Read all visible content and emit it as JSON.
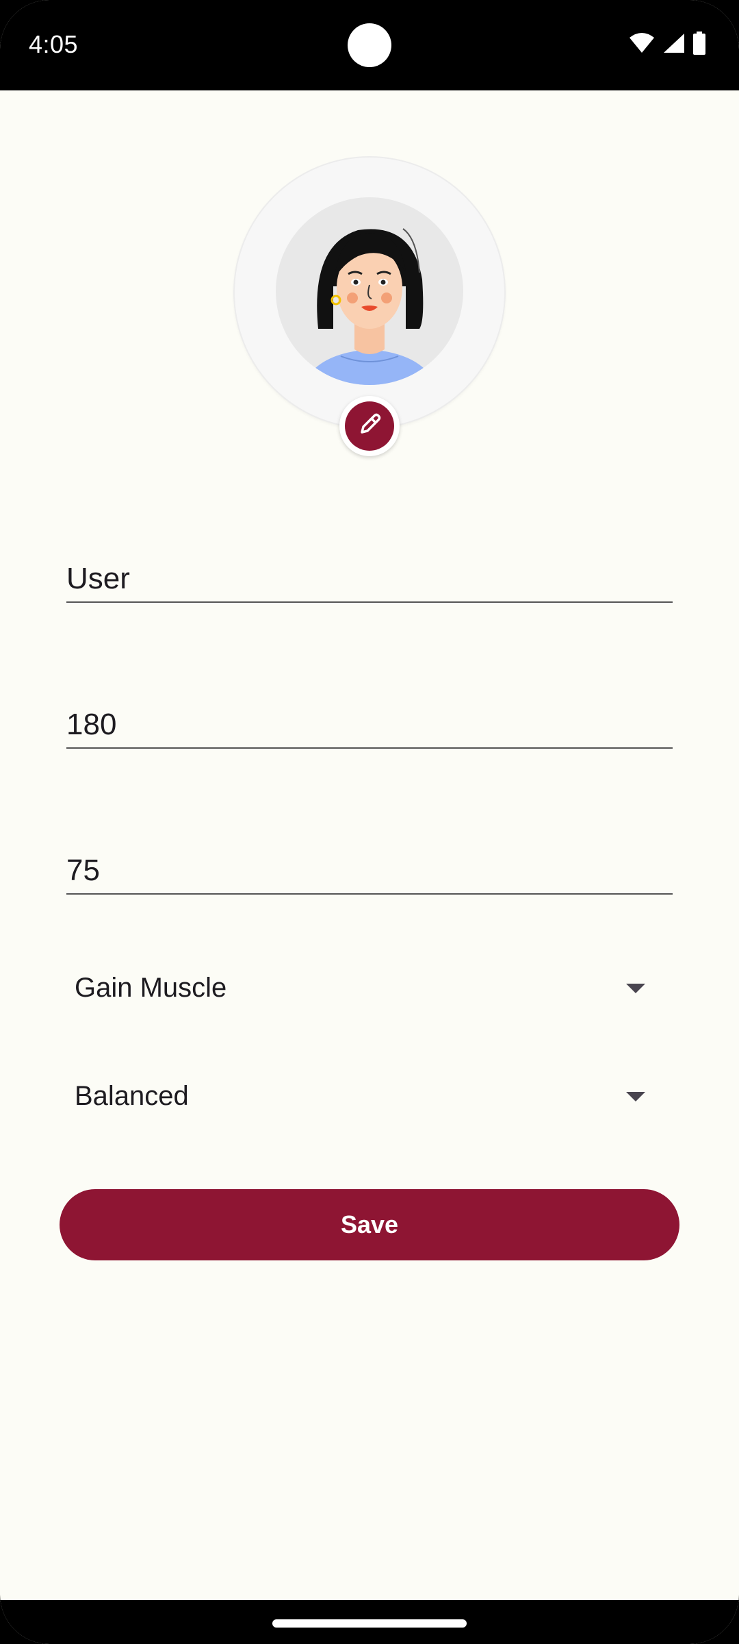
{
  "status_bar": {
    "time": "4:05",
    "icons": [
      "wifi-icon",
      "signal-icon",
      "battery-icon"
    ]
  },
  "profile": {
    "avatar_icon": "avatar-illustration",
    "edit_icon": "pencil-icon"
  },
  "form": {
    "name_value": "User",
    "height_value": "180",
    "weight_value": "75",
    "goal_selected": "Gain Muscle",
    "diet_selected": "Balanced",
    "save_label": "Save"
  },
  "colors": {
    "accent": "#8e1533",
    "background": "#fcfcf6",
    "text": "#1d1b20"
  }
}
